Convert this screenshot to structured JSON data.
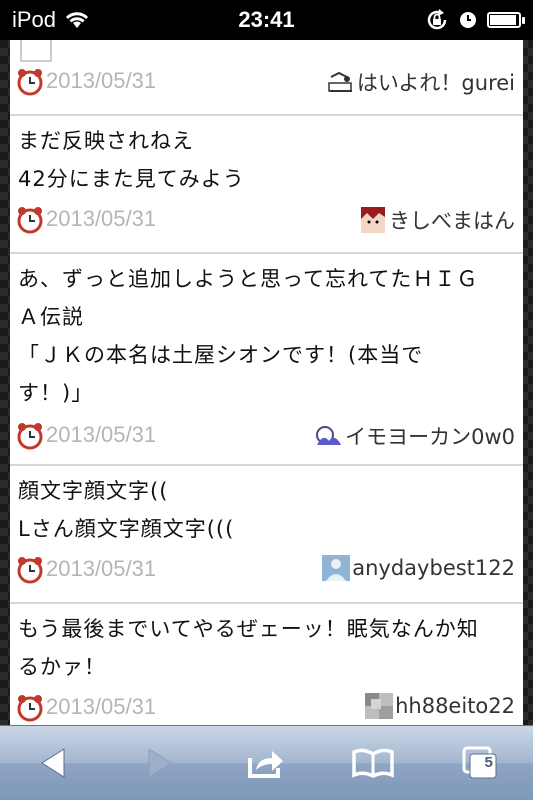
{
  "status_bar": {
    "carrier": "iPod",
    "time": "23:41"
  },
  "posts": [
    {
      "lines": [],
      "date": "2013/05/31",
      "username": "はいよれ！gurei",
      "avatar_icon": "cartoon-avatar-icon"
    },
    {
      "lines": [
        "まだ反映されねえ",
        "42分にまた見てみよう"
      ],
      "date": "2013/05/31",
      "username": "きしべまはん",
      "avatar_icon": "red-hair-avatar-icon"
    },
    {
      "lines": [
        "あ、ずっと追加しようと思って忘れてたＨＩＧ",
        "Ａ伝説",
        "「ＪＫの本名は土屋シオンです！(本当で",
        "す！)」"
      ],
      "date": "2013/05/31",
      "username": "イモヨーカン0w0",
      "avatar_icon": "wave-avatar-icon"
    },
    {
      "lines": [
        "顔文字顔文字((",
        "Lさん顔文字顔文字((("
      ],
      "date": "2013/05/31",
      "username": "anydaybest122",
      "avatar_icon": "default-user-avatar-icon"
    },
    {
      "lines": [
        "もう最後までいてやるぜェーッ！眠気なんか知",
        "るかァ！"
      ],
      "date": "2013/05/31",
      "username": "hh88eito22",
      "avatar_icon": "photo-avatar-icon"
    }
  ],
  "toolbar": {
    "tabs_count": "5"
  }
}
